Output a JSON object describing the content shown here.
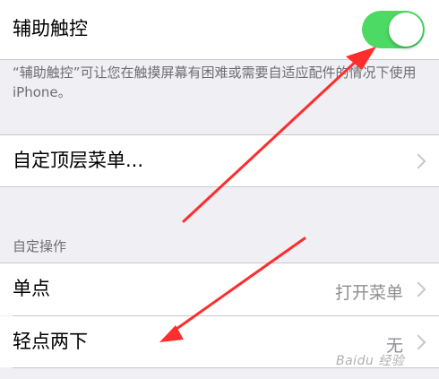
{
  "assistive_touch": {
    "label": "辅助触控",
    "toggle_on": true,
    "footer": "“辅助触控”可让您在触摸屏幕有困难或需要自适应配件的情况下使用 iPhone。"
  },
  "customize_top_menu": {
    "label": "自定顶层菜单..."
  },
  "custom_actions": {
    "header": "自定操作",
    "rows": [
      {
        "label": "单点",
        "value": "打开菜单"
      },
      {
        "label": "轻点两下",
        "value": "无"
      }
    ]
  },
  "watermark": "Baidu 经验",
  "colors": {
    "toggle_on": "#4cd964",
    "arrow": "#ff2d2d",
    "group_bg": "#efeff4"
  }
}
